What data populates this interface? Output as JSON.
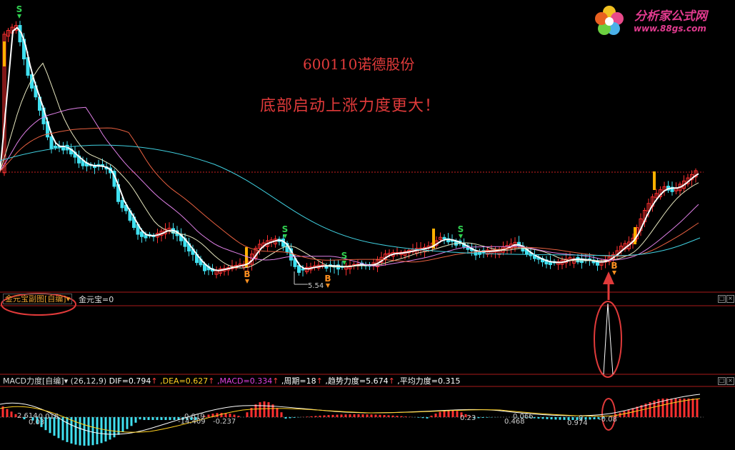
{
  "stock_title": "600110诺德股份",
  "slogan": "底部启动上涨力度更大！",
  "logo": {
    "main": "分析家公式网",
    "url": "www.88gs.com"
  },
  "price_low_label": "5.54",
  "signals": {
    "sell": "S",
    "buy": "B"
  },
  "sub_panel": {
    "menu": "金元宝副图[自编]",
    "dropdown_icon": "triangle-down",
    "value_label": "金元宝=0"
  },
  "macd_panel": {
    "name": "MACD力度[自编]",
    "params": "(26,12,9)",
    "dif": "DIF=0.794",
    "dea": ",DEA=0.627",
    "macd": ",MACD=0.334",
    "period": ",周期=18",
    "trend": ",趋势力度=5.674",
    "avg": ",平均力度=0.315",
    "arrow": "↑",
    "value_labels": [
      "2.614",
      "-0.016",
      "0.03",
      "0.019",
      "-14.409",
      "-0.237",
      "0.23",
      "0.066",
      "0.468",
      "0.974",
      "0",
      "-0.08"
    ]
  },
  "colors": {
    "background": "#000000",
    "up_candle": "#ff3030",
    "down_candle": "#40e0f0",
    "signal_bar": "#ffb000",
    "sell_signal": "#30d050",
    "buy_signal": "#ff9020",
    "annotation": "#e03a3a"
  }
}
